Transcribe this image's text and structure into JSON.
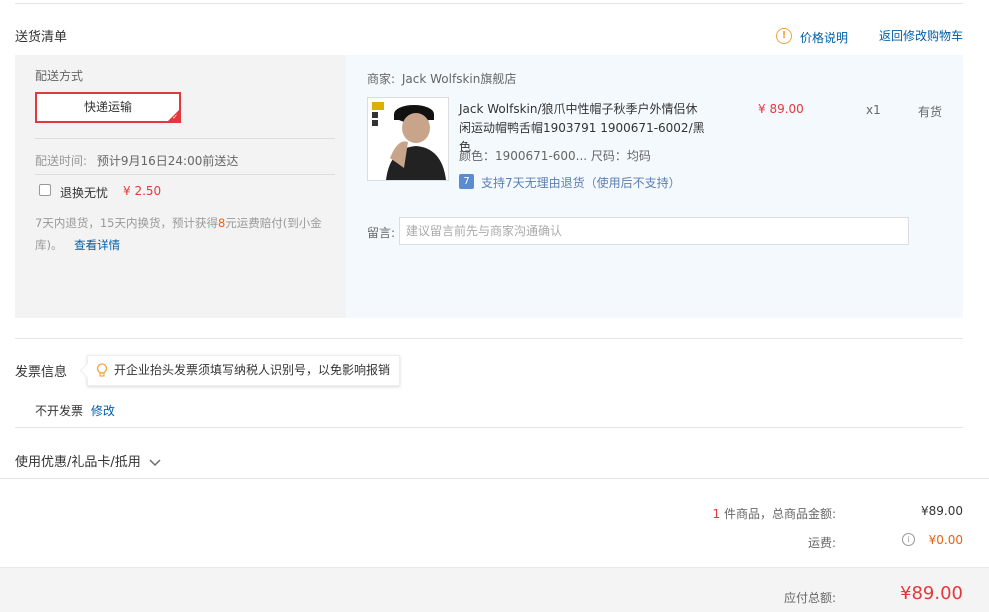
{
  "delivery": {
    "title": "送货清单",
    "price_note": "价格说明",
    "back_to_cart": "返回修改购物车",
    "shipping": {
      "label": "配送方式",
      "method": "快递运输",
      "time_label": "配送时间:",
      "time_value": "预计9月16日24:00前送达"
    },
    "return_service": {
      "label": "退换无忧",
      "price": "¥ 2.50",
      "desc_prefix": "7天内退货，15天内换货，预计获得",
      "desc_highlight": "8",
      "desc_suffix": "元运费赔付(到小金",
      "desc_line2": "库)。",
      "detail_link": "查看详情"
    },
    "merchant": {
      "label": "商家:",
      "name": "Jack Wolfskin旗舰店"
    },
    "product": {
      "title_line1": "Jack Wolfskin/狼爪中性帽子秋季户外情侣休",
      "title_line2": "闲运动帽鸭舌帽1903791 1900671-6002/黑色",
      "attrs": "颜色：1900671-600... 尺码：均码",
      "service_badge": "7",
      "service_text": "支持7天无理由退货（使用后不支持）",
      "price": "¥ 89.00",
      "qty": "x1",
      "stock": "有货"
    },
    "note": {
      "label": "留言:",
      "placeholder": "建议留言前先与商家沟通确认"
    }
  },
  "invoice": {
    "title": "发票信息",
    "tip": "开企业抬头发票须填写纳税人识别号，以免影响报销",
    "status": "不开发票",
    "modify": "修改"
  },
  "coupon": {
    "label": "使用优惠/礼品卡/抵用"
  },
  "summary": {
    "count": "1",
    "count_suffix": " 件商品，总商品金额:",
    "goods_total": "¥89.00",
    "freight_label": "运费:",
    "freight_value": "¥0.00",
    "payable_label": "应付总额:",
    "payable_value": "¥89.00"
  },
  "colors": {
    "accent": "#e4393c",
    "link": "#005ea7",
    "warn": "#f7a13a",
    "orange": "#e96012"
  }
}
